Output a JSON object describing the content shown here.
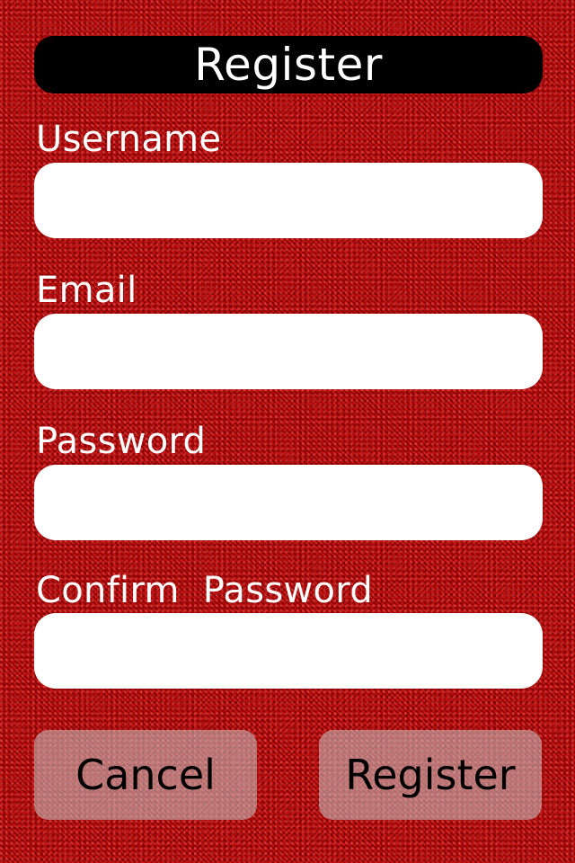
{
  "header": {
    "title": "Register"
  },
  "form": {
    "fields": [
      {
        "label": "Username",
        "value": ""
      },
      {
        "label": "Email",
        "value": ""
      },
      {
        "label": "Password",
        "value": ""
      },
      {
        "label": "Confirm  Password",
        "value": ""
      }
    ]
  },
  "buttons": {
    "cancel_label": "Cancel",
    "register_label": "Register"
  },
  "colors": {
    "background": "#b00000",
    "header_bg": "#000000",
    "field_bg": "#ffffff",
    "button_bg": "#c8c8c8"
  }
}
